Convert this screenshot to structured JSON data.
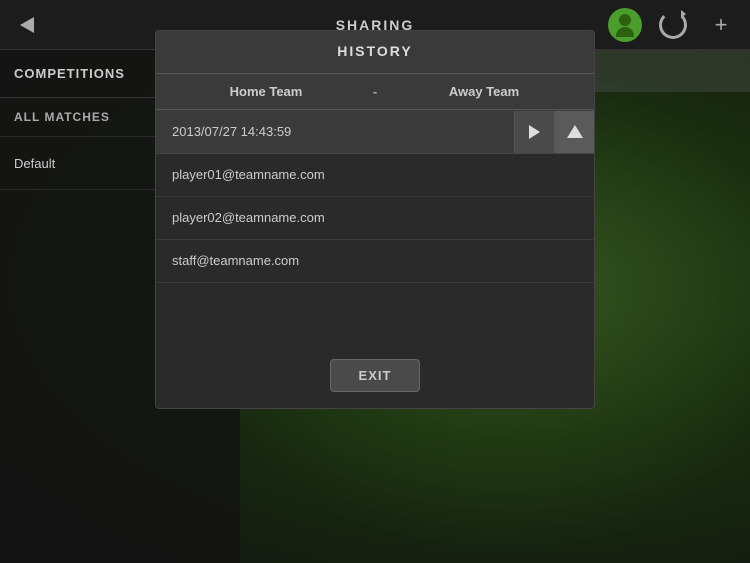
{
  "topbar": {
    "title": "SHARING",
    "back_label": "back"
  },
  "sidebar": {
    "title": "COMPETITIONS",
    "add_label": "+",
    "section_label": "ALL MATCHES",
    "default_item": "Default"
  },
  "main_header": {
    "label": ""
  },
  "modal": {
    "title": "HISTORY",
    "table": {
      "col_home": "Home Team",
      "col_separator": "-",
      "col_away": "Away Team"
    },
    "history_rows": [
      {
        "date": "2013/07/27 14:43:59",
        "active": true
      }
    ],
    "recipients": [
      {
        "email": "player01@teamname.com"
      },
      {
        "email": "player02@teamname.com"
      },
      {
        "email": "staff@teamname.com"
      }
    ],
    "exit_label": "EXIT"
  },
  "icons": {
    "back": "◀",
    "add": "+",
    "gear": "⚙",
    "person": "👤",
    "plus": "+",
    "arrow_right": "→",
    "arrow_up": "▲"
  }
}
